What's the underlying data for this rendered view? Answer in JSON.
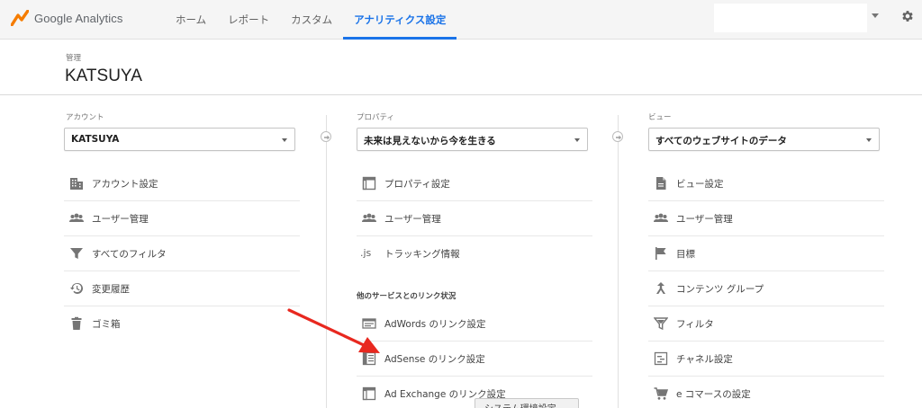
{
  "app": {
    "logo_text": "Google Analytics"
  },
  "nav": {
    "tabs": [
      {
        "label": "ホーム"
      },
      {
        "label": "レポート"
      },
      {
        "label": "カスタム"
      },
      {
        "label": "アナリティクス設定"
      }
    ]
  },
  "header": {
    "breadcrumb": "管理",
    "title": "KATSUYA"
  },
  "account": {
    "label": "アカウント",
    "selected": "KATSUYA",
    "items": [
      {
        "label": "アカウント設定",
        "icon": "building-icon"
      },
      {
        "label": "ユーザー管理",
        "icon": "users-icon"
      },
      {
        "label": "すべてのフィルタ",
        "icon": "filter-icon"
      },
      {
        "label": "変更履歴",
        "icon": "history-icon"
      },
      {
        "label": "ゴミ箱",
        "icon": "trash-icon"
      }
    ]
  },
  "property": {
    "label": "プロパティ",
    "selected": "未来は見えないから今を生きる",
    "items": [
      {
        "label": "プロパティ設定",
        "icon": "property-icon"
      },
      {
        "label": "ユーザー管理",
        "icon": "users-icon"
      },
      {
        "label": "トラッキング情報",
        "icon": "js-icon",
        "icon_text": ".js"
      }
    ],
    "section_label": "他のサービスとのリンク状況",
    "link_items": [
      {
        "label": "AdWords のリンク設定",
        "icon": "adwords-icon"
      },
      {
        "label": "AdSense のリンク設定",
        "icon": "adsense-icon"
      },
      {
        "label": "Ad Exchange のリンク設定",
        "icon": "adexchange-icon"
      }
    ]
  },
  "view": {
    "label": "ビュー",
    "selected": "すべてのウェブサイトのデータ",
    "items": [
      {
        "label": "ビュー設定",
        "icon": "document-icon"
      },
      {
        "label": "ユーザー管理",
        "icon": "users-icon"
      },
      {
        "label": "目標",
        "icon": "flag-icon"
      },
      {
        "label": "コンテンツ グループ",
        "icon": "content-group-icon"
      },
      {
        "label": "フィルタ",
        "icon": "filter-icon"
      },
      {
        "label": "チャネル設定",
        "icon": "channel-icon"
      },
      {
        "label": "e コマースの設定",
        "icon": "cart-icon"
      }
    ]
  },
  "tooltip": {
    "text": "システム環境設定"
  },
  "colors": {
    "accent": "#1a73e8",
    "annotation_arrow": "#e8281f",
    "logo_orange": "#f57c00"
  }
}
